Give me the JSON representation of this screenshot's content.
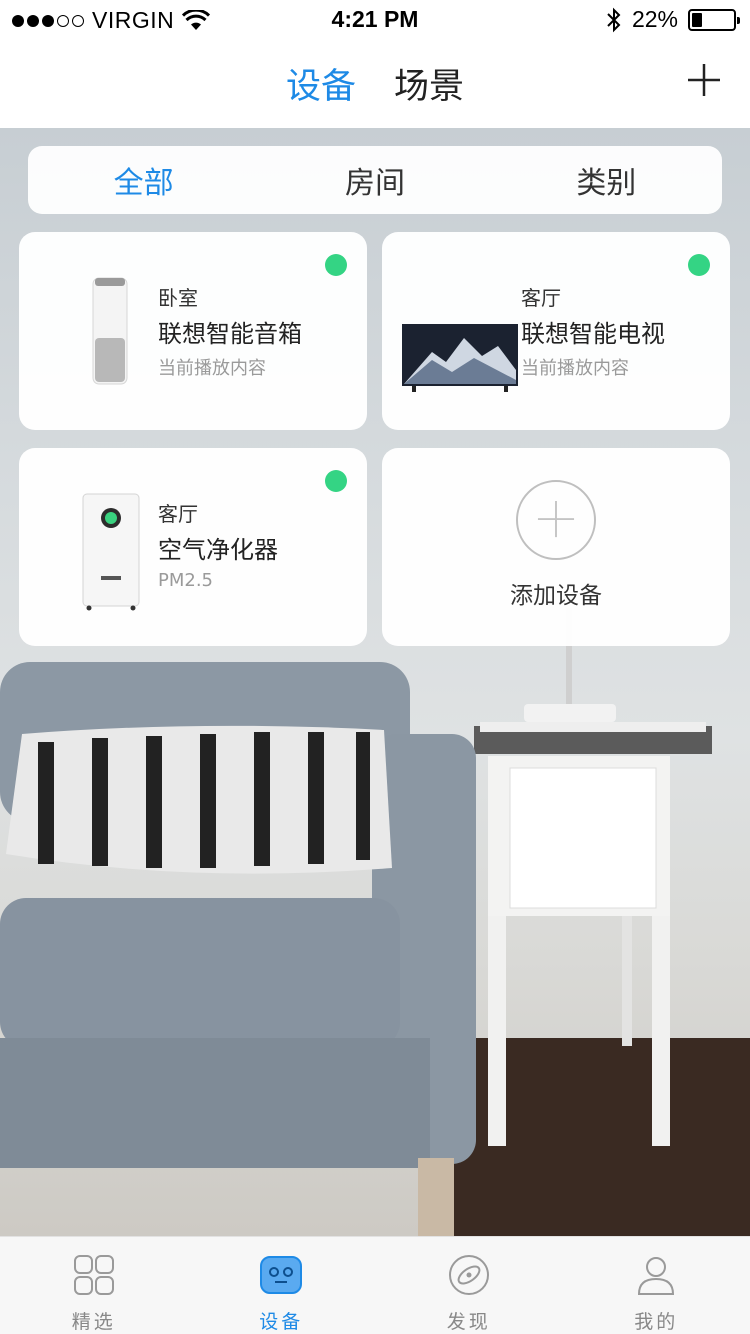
{
  "status_bar": {
    "carrier": "VIRGIN",
    "time": "4:21 PM",
    "battery_percent": "22%",
    "battery_level": 0.22,
    "signal_strength": 3,
    "signal_max": 5
  },
  "header": {
    "tabs": [
      {
        "label": "设备",
        "active": true
      },
      {
        "label": "场景",
        "active": false
      }
    ],
    "add_icon": "plus-icon"
  },
  "filter": {
    "tabs": [
      {
        "label": "全部",
        "active": true
      },
      {
        "label": "房间",
        "active": false
      },
      {
        "label": "类别",
        "active": false
      }
    ]
  },
  "devices": [
    {
      "room": "卧室",
      "name": "联想智能音箱",
      "status": "当前播放内容",
      "online": true,
      "icon": "smart-speaker"
    },
    {
      "room": "客厅",
      "name": "联想智能电视",
      "status": "当前播放内容",
      "online": true,
      "icon": "smart-tv"
    },
    {
      "room": "客厅",
      "name": "空气净化器",
      "status": "PM2.5",
      "online": true,
      "icon": "air-purifier"
    }
  ],
  "add_device": {
    "label": "添加设备",
    "icon": "plus-circle-icon"
  },
  "tabbar": {
    "items": [
      {
        "label": "精选",
        "icon": "grid-icon",
        "active": false
      },
      {
        "label": "设备",
        "icon": "robot-icon",
        "active": true
      },
      {
        "label": "发现",
        "icon": "discover-icon",
        "active": false
      },
      {
        "label": "我的",
        "icon": "user-icon",
        "active": false
      }
    ]
  },
  "colors": {
    "accent": "#1e8ae6",
    "online": "#34d484"
  }
}
